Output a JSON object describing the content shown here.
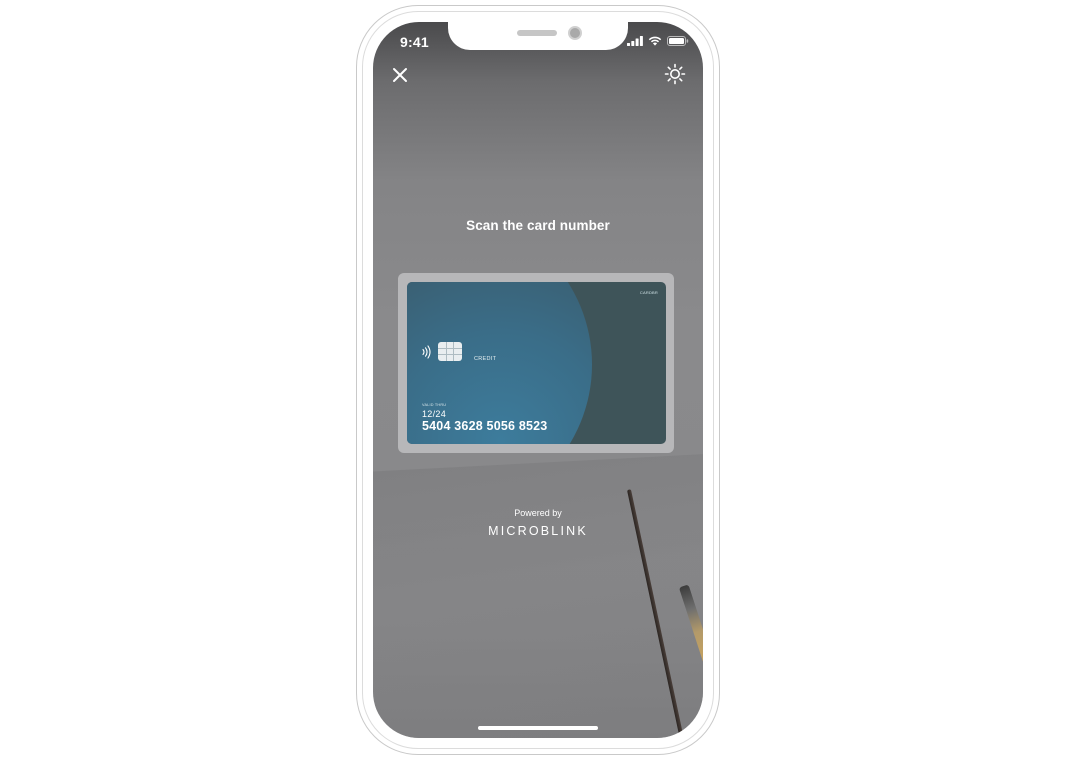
{
  "status_bar": {
    "time": "9:41",
    "icons": [
      "cellular-signal-icon",
      "wifi-icon",
      "battery-icon"
    ]
  },
  "toolbar": {
    "close_icon": "close-icon",
    "torch_icon": "flashlight-icon"
  },
  "scanner": {
    "instruction": "Scan the card number"
  },
  "card": {
    "brand": "CARDBR",
    "type": "CREDIT",
    "valid_thru_label": "VALID THRU",
    "expiry": "12/24",
    "number": "5404 3628 5056 8523",
    "colors": {
      "background": "#3e5459",
      "accent": "#3d7c9c"
    }
  },
  "footer": {
    "powered_by": "Powered by",
    "brand": "MICROBLINK"
  },
  "colors": {
    "frame": "#b7b7b9",
    "overlay": "#88888a",
    "text": "#ffffff"
  }
}
